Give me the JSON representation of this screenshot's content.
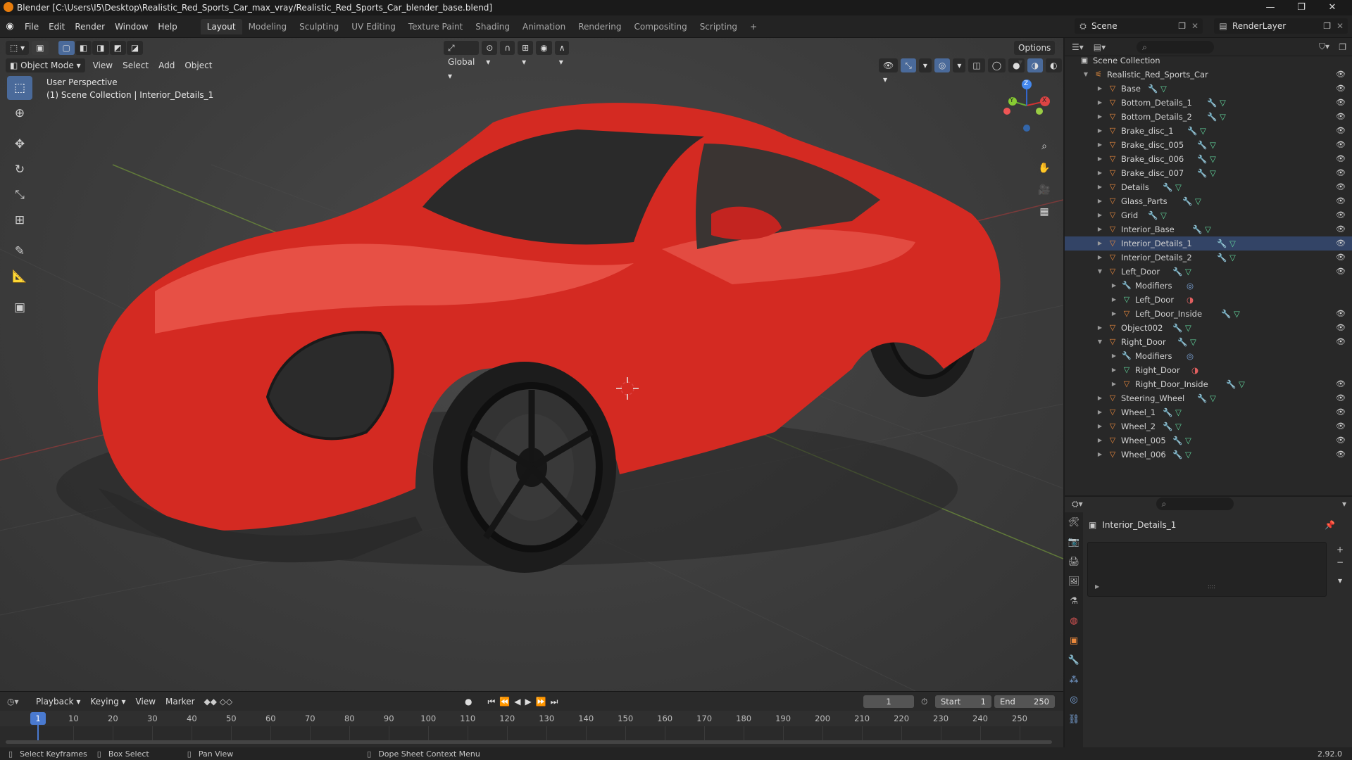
{
  "window": {
    "title": "Blender [C:\\Users\\I5\\Desktop\\Realistic_Red_Sports_Car_max_vray/Realistic_Red_Sports_Car_blender_base.blend]",
    "controls": [
      "—",
      "❐",
      "✕"
    ]
  },
  "menubar": {
    "menus": [
      "File",
      "Edit",
      "Render",
      "Window",
      "Help"
    ],
    "workspaces": [
      "Layout",
      "Modeling",
      "Sculpting",
      "UV Editing",
      "Texture Paint",
      "Shading",
      "Animation",
      "Rendering",
      "Compositing",
      "Scripting"
    ],
    "active_workspace": "Layout",
    "add_tab": "+",
    "scene_label": "Scene",
    "render_layer_label": "RenderLayer"
  },
  "viewport": {
    "mode": "Object Mode",
    "menus": [
      "View",
      "Select",
      "Add",
      "Object"
    ],
    "transform_orientation": "Global",
    "options_label": "Options",
    "overlay_line1": "User Perspective",
    "overlay_line2": "(1) Scene Collection | Interior_Details_1",
    "gizmo_axes": {
      "x": "X",
      "y": "Y",
      "z": "Z"
    }
  },
  "outliner": {
    "root": "Scene Collection",
    "collection": "Realistic_Red_Sports_Car",
    "rows": [
      {
        "label": "Base",
        "level": 0,
        "type": "object",
        "expanded": false,
        "selected": false
      },
      {
        "label": "Bottom_Details_1",
        "level": 0,
        "type": "object",
        "expanded": false,
        "selected": false
      },
      {
        "label": "Bottom_Details_2",
        "level": 0,
        "type": "object",
        "expanded": false,
        "selected": false
      },
      {
        "label": "Brake_disc_1",
        "level": 0,
        "type": "object",
        "expanded": false,
        "selected": false
      },
      {
        "label": "Brake_disc_005",
        "level": 0,
        "type": "object",
        "expanded": false,
        "selected": false
      },
      {
        "label": "Brake_disc_006",
        "level": 0,
        "type": "object",
        "expanded": false,
        "selected": false
      },
      {
        "label": "Brake_disc_007",
        "level": 0,
        "type": "object",
        "expanded": false,
        "selected": false
      },
      {
        "label": "Details",
        "level": 0,
        "type": "object",
        "expanded": false,
        "selected": false
      },
      {
        "label": "Glass_Parts",
        "level": 0,
        "type": "object",
        "expanded": false,
        "selected": false
      },
      {
        "label": "Grid",
        "level": 0,
        "type": "object",
        "expanded": false,
        "selected": false
      },
      {
        "label": "Interior_Base",
        "level": 0,
        "type": "object",
        "expanded": false,
        "selected": false
      },
      {
        "label": "Interior_Details_1",
        "level": 0,
        "type": "object",
        "expanded": false,
        "selected": true
      },
      {
        "label": "Interior_Details_2",
        "level": 0,
        "type": "object",
        "expanded": false,
        "selected": false
      },
      {
        "label": "Left_Door",
        "level": 0,
        "type": "object",
        "expanded": true,
        "selected": false
      },
      {
        "label": "Modifiers",
        "level": 1,
        "type": "modifiers",
        "expanded": false,
        "selected": false
      },
      {
        "label": "Left_Door",
        "level": 1,
        "type": "mesh",
        "expanded": false,
        "selected": false
      },
      {
        "label": "Left_Door_Inside",
        "level": 1,
        "type": "object",
        "expanded": false,
        "selected": false
      },
      {
        "label": "Object002",
        "level": 0,
        "type": "object",
        "expanded": false,
        "selected": false
      },
      {
        "label": "Right_Door",
        "level": 0,
        "type": "object",
        "expanded": true,
        "selected": false
      },
      {
        "label": "Modifiers",
        "level": 1,
        "type": "modifiers",
        "expanded": false,
        "selected": false
      },
      {
        "label": "Right_Door",
        "level": 1,
        "type": "mesh",
        "expanded": false,
        "selected": false
      },
      {
        "label": "Right_Door_Inside",
        "level": 1,
        "type": "object",
        "expanded": false,
        "selected": false
      },
      {
        "label": "Steering_Wheel",
        "level": 0,
        "type": "object",
        "expanded": false,
        "selected": false
      },
      {
        "label": "Wheel_1",
        "level": 0,
        "type": "object",
        "expanded": false,
        "selected": false
      },
      {
        "label": "Wheel_2",
        "level": 0,
        "type": "object",
        "expanded": false,
        "selected": false
      },
      {
        "label": "Wheel_005",
        "level": 0,
        "type": "object",
        "expanded": false,
        "selected": false
      },
      {
        "label": "Wheel_006",
        "level": 0,
        "type": "object",
        "expanded": false,
        "selected": false
      }
    ]
  },
  "properties": {
    "object_name": "Interior_Details_1",
    "list_handle": "::::"
  },
  "timeline": {
    "menus": [
      "Playback",
      "Keying",
      "View",
      "Marker"
    ],
    "current_frame": "1",
    "start_label": "Start",
    "start_value": "1",
    "end_label": "End",
    "end_value": "250",
    "ticks": [
      "1",
      "10",
      "20",
      "30",
      "40",
      "50",
      "60",
      "70",
      "80",
      "90",
      "100",
      "110",
      "120",
      "130",
      "140",
      "150",
      "160",
      "170",
      "180",
      "190",
      "200",
      "210",
      "220",
      "230",
      "240",
      "250"
    ]
  },
  "statusbar": {
    "items": [
      "Select Keyframes",
      "Box Select",
      "Pan View",
      "Dope Sheet Context Menu"
    ],
    "version": "2.92.0"
  },
  "colors": {
    "car_red": "#d42a22",
    "accent_blue": "#4a6a9a",
    "selection": "#334466",
    "object_orange": "#e8883c"
  }
}
